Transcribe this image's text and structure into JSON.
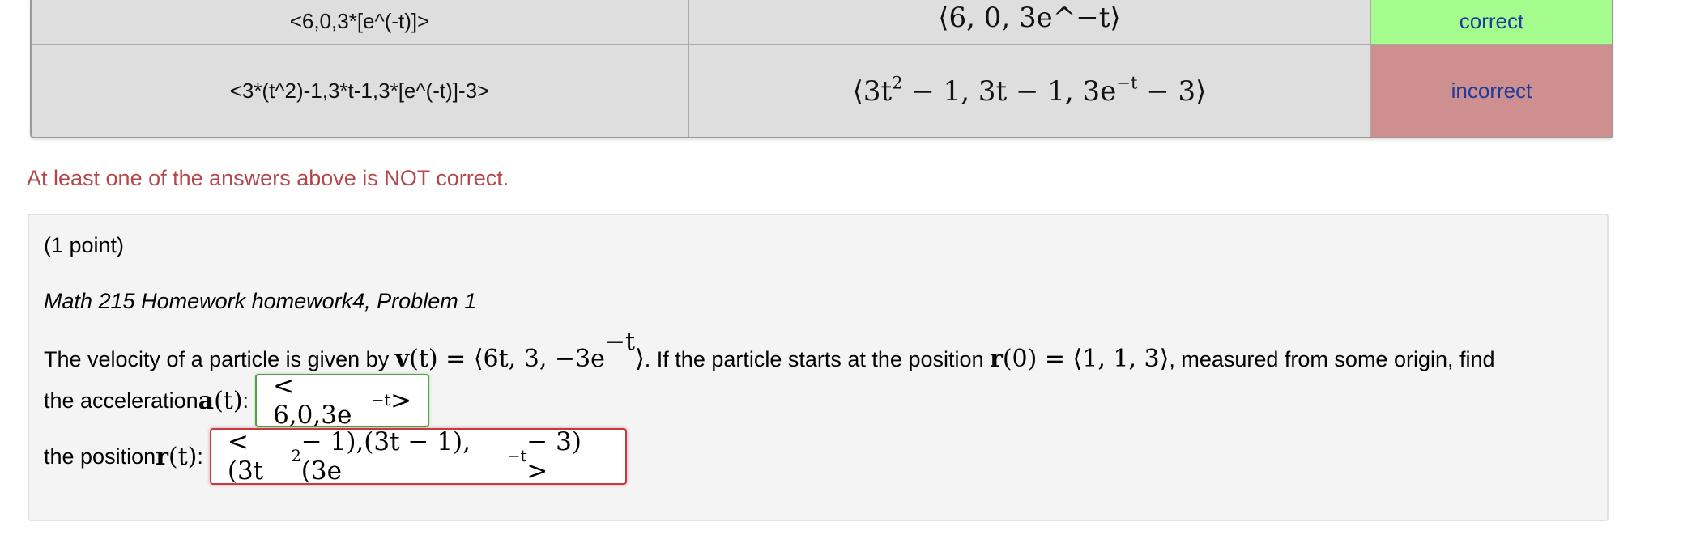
{
  "results": {
    "rows": [
      {
        "entered": "<6,0,3*[e^(-t)]>",
        "preview": "⟨6, 0, 3e^−t⟩",
        "status": "correct",
        "status_color": "#a4fd8d"
      },
      {
        "entered": "<3*(t^2)-1,3*t-1,3*[e^(-t)]-3>",
        "preview_parts": [
          "⟨3t",
          "2",
          " − 1, 3t − 1, 3e",
          "−t",
          " − 3⟩"
        ],
        "status": "incorrect",
        "status_color": "#cd8f8f"
      }
    ]
  },
  "feedback": {
    "message": "At least one of the answers above is NOT correct.",
    "color": "#b4474a"
  },
  "problem": {
    "points": "(1 point)",
    "title": "Math 215 Homework homework4, Problem 1",
    "statement": {
      "t1": "The velocity of a particle is given by ",
      "v_expr_a": "v",
      "v_expr_b": "(t) = ⟨6t, 3, −3e",
      "v_exp": "−t",
      "v_expr_c": "⟩",
      "t2": ". If the particle starts at the position ",
      "r_a": "r",
      "r_b": "(0) = ⟨1, 1, 3⟩",
      "t3": ", measured from some origin, find"
    },
    "acceleration": {
      "label_text": "the acceleration ",
      "sym": "a",
      "arg": "(t)",
      "colon": ":",
      "answer_a": "< 6,0,3e",
      "answer_exp": "−t",
      "answer_b": " >",
      "state": "correct"
    },
    "position": {
      "label_text": "the position ",
      "sym": "r",
      "arg": "(t)",
      "colon": ":",
      "answer_a": "< (3t",
      "answer_exp1": "2",
      "answer_b": " − 1),(3t − 1),(3e",
      "answer_exp2": "−t",
      "answer_c": " − 3) >",
      "state": "incorrect"
    }
  }
}
